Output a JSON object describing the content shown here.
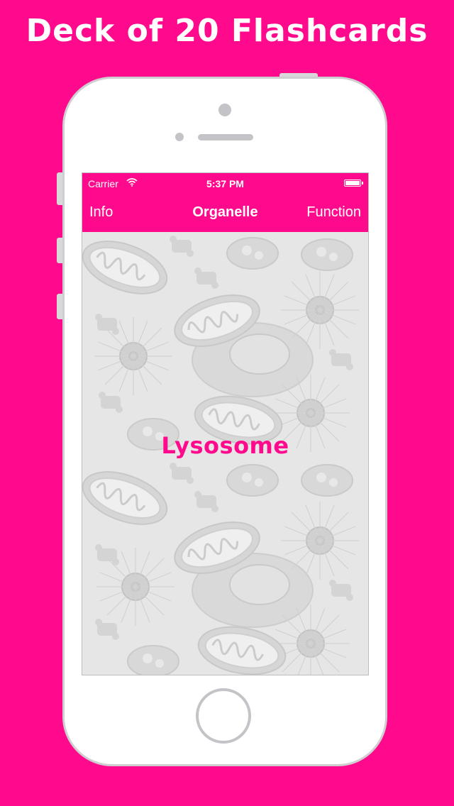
{
  "headline": "Deck of 20 Flashcards",
  "status_bar": {
    "carrier": "Carrier",
    "wifi_icon": "wifi-icon",
    "time": "5:37 PM",
    "battery_icon": "battery-icon"
  },
  "nav": {
    "left_label": "Info",
    "title": "Organelle",
    "right_label": "Function"
  },
  "card": {
    "term": "Lysosome",
    "background_icon": "organelle-pattern"
  },
  "colors": {
    "accent": "#FF0A8C",
    "card_background": "#E6E6E6",
    "text_on_accent": "#FFFFFF"
  }
}
